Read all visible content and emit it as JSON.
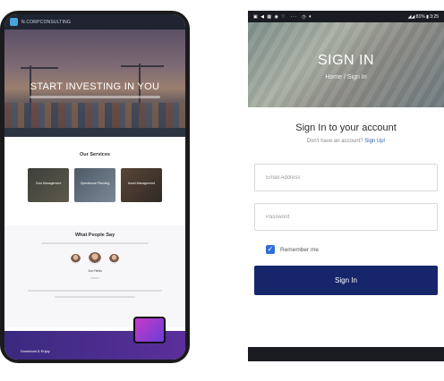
{
  "left_phone": {
    "brand": "N.CORPCONSULTING",
    "hero": {
      "title": "START INVESTING IN YOU"
    },
    "services": {
      "title": "Our Services",
      "items": [
        {
          "label": "Cost Management"
        },
        {
          "label": "Operational Planning"
        },
        {
          "label": "Asset Management"
        }
      ]
    },
    "testimonials": {
      "title": "What People Say",
      "name": "Jon Fields"
    },
    "footer": {
      "text": "Download & Enjoy"
    }
  },
  "right_phone": {
    "status_bar": {
      "battery": "81%",
      "time": "3:25"
    },
    "hero": {
      "title": "SIGN IN",
      "breadcrumb": "Home  /  Sign In"
    },
    "form": {
      "heading": "Sign In to your account",
      "no_account_text": "Don't have an account?",
      "signup_link": "Sign Up!",
      "email_placeholder": "Email Address",
      "password_placeholder": "Password",
      "remember_label": "Remember me",
      "remember_checked": true,
      "submit_label": "Sign In"
    },
    "colors": {
      "button": "#17266b",
      "link": "#2f5ea8",
      "checkbox": "#2f6fd6"
    }
  }
}
